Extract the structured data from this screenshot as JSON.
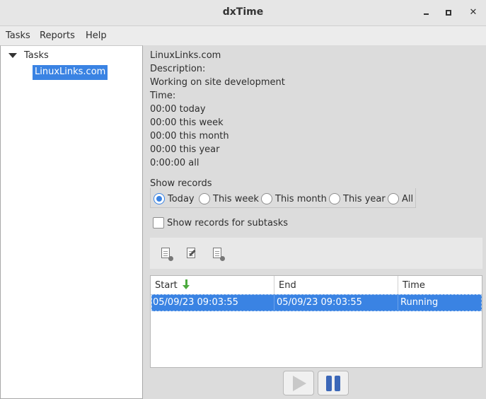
{
  "window": {
    "title": "dxTime",
    "minimize_glyph": "▪",
    "maximize_glyph": "□",
    "close_glyph": "✕"
  },
  "menu": {
    "items": [
      "Tasks",
      "Reports",
      "Help"
    ]
  },
  "tree": {
    "root_label": "Tasks",
    "child_label": "LinuxLinks.com"
  },
  "details": {
    "name": "LinuxLinks.com",
    "description_label": "Description:",
    "description": "Working on site development",
    "time_label": "Time:",
    "today": "00:00 today",
    "week": "00:00 this week",
    "month": "00:00 this month",
    "year": "00:00 this year",
    "all": "0:00:00 all"
  },
  "records": {
    "frame_label": "Show records",
    "options": [
      "Today",
      "This week",
      "This month",
      "This year",
      "All"
    ],
    "selected": "Today",
    "subtasks_label": "Show records for subtasks",
    "subtasks_checked": false
  },
  "toolbar": {
    "icons": [
      "add-record-icon",
      "edit-record-icon",
      "delete-record-icon"
    ]
  },
  "table": {
    "columns": [
      "Start",
      "End",
      "Time"
    ],
    "rows": [
      {
        "start": "05/09/23 09:03:55",
        "end": "05/09/23 09:03:55",
        "time": "Running"
      }
    ]
  },
  "controls": {
    "play_icon": "play-icon",
    "pause_icon": "pause-icon"
  },
  "colors": {
    "accent": "#3a83e3",
    "sort_arrow": "#4caa3e",
    "pause": "#3b67b8"
  }
}
